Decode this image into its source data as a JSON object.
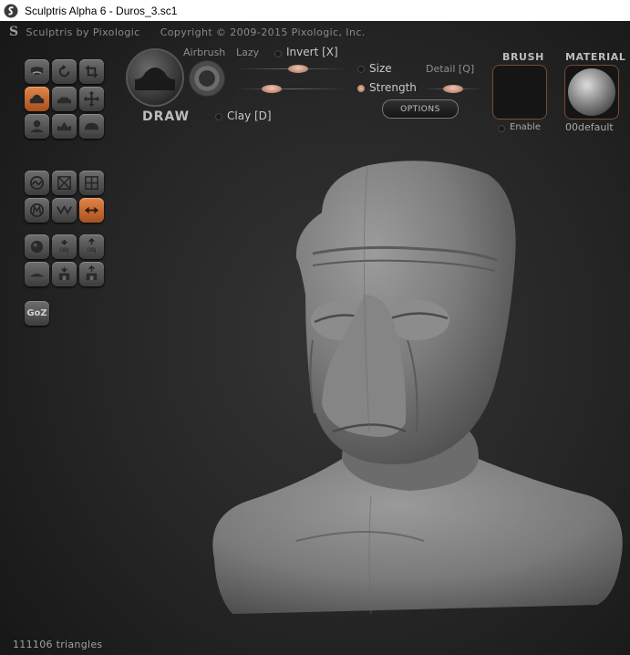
{
  "window": {
    "title": "Sculptris Alpha 6 - Duros_3.sc1"
  },
  "header": {
    "app_name": "Sculptris by Pixologic",
    "copyright": "Copyright © 2009-2015 Pixologic, Inc."
  },
  "tools": {
    "rows": [
      [
        "mask-icon",
        "rotate-icon",
        "scale-icon"
      ],
      [
        "draw-tool-icon",
        "flatten-icon",
        "grab-icon"
      ],
      [
        "crease-icon",
        "inflate-icon",
        "pinch-icon"
      ],
      [
        "reduce-brush-icon",
        "reduce-selected-icon",
        "subdivide-icon"
      ],
      [
        "mirror-icon",
        "symmetry-icon",
        "swap-icon"
      ],
      [
        "sphere-icon",
        "import-obj-icon",
        "export-obj-icon"
      ],
      [
        "plane-icon",
        "open-icon",
        "save-icon"
      ]
    ],
    "active": [
      "draw-tool-icon",
      "swap-icon"
    ],
    "goz_label": "GoZ"
  },
  "brush_panel": {
    "mode_label": "DRAW",
    "airbrush_label": "Airbrush",
    "lazy_label": "Lazy",
    "invert_label": "Invert [X]",
    "invert_on": false,
    "size_label": "Size",
    "size_on": false,
    "strength_label": "Strength",
    "strength_on": true,
    "detail_label": "Detail [Q]",
    "clay_label": "Clay [D]",
    "clay_on": false,
    "options_label": "OPTIONS"
  },
  "brush_preview": {
    "title": "BRUSH",
    "enable_label": "Enable",
    "enable_on": false
  },
  "material": {
    "title": "MATERIAL",
    "name": "00default"
  },
  "status": {
    "triangles": "111106 triangles"
  },
  "colors": {
    "accent": "#d07038",
    "panel_border": "#7a4a35",
    "background": "#232323"
  }
}
